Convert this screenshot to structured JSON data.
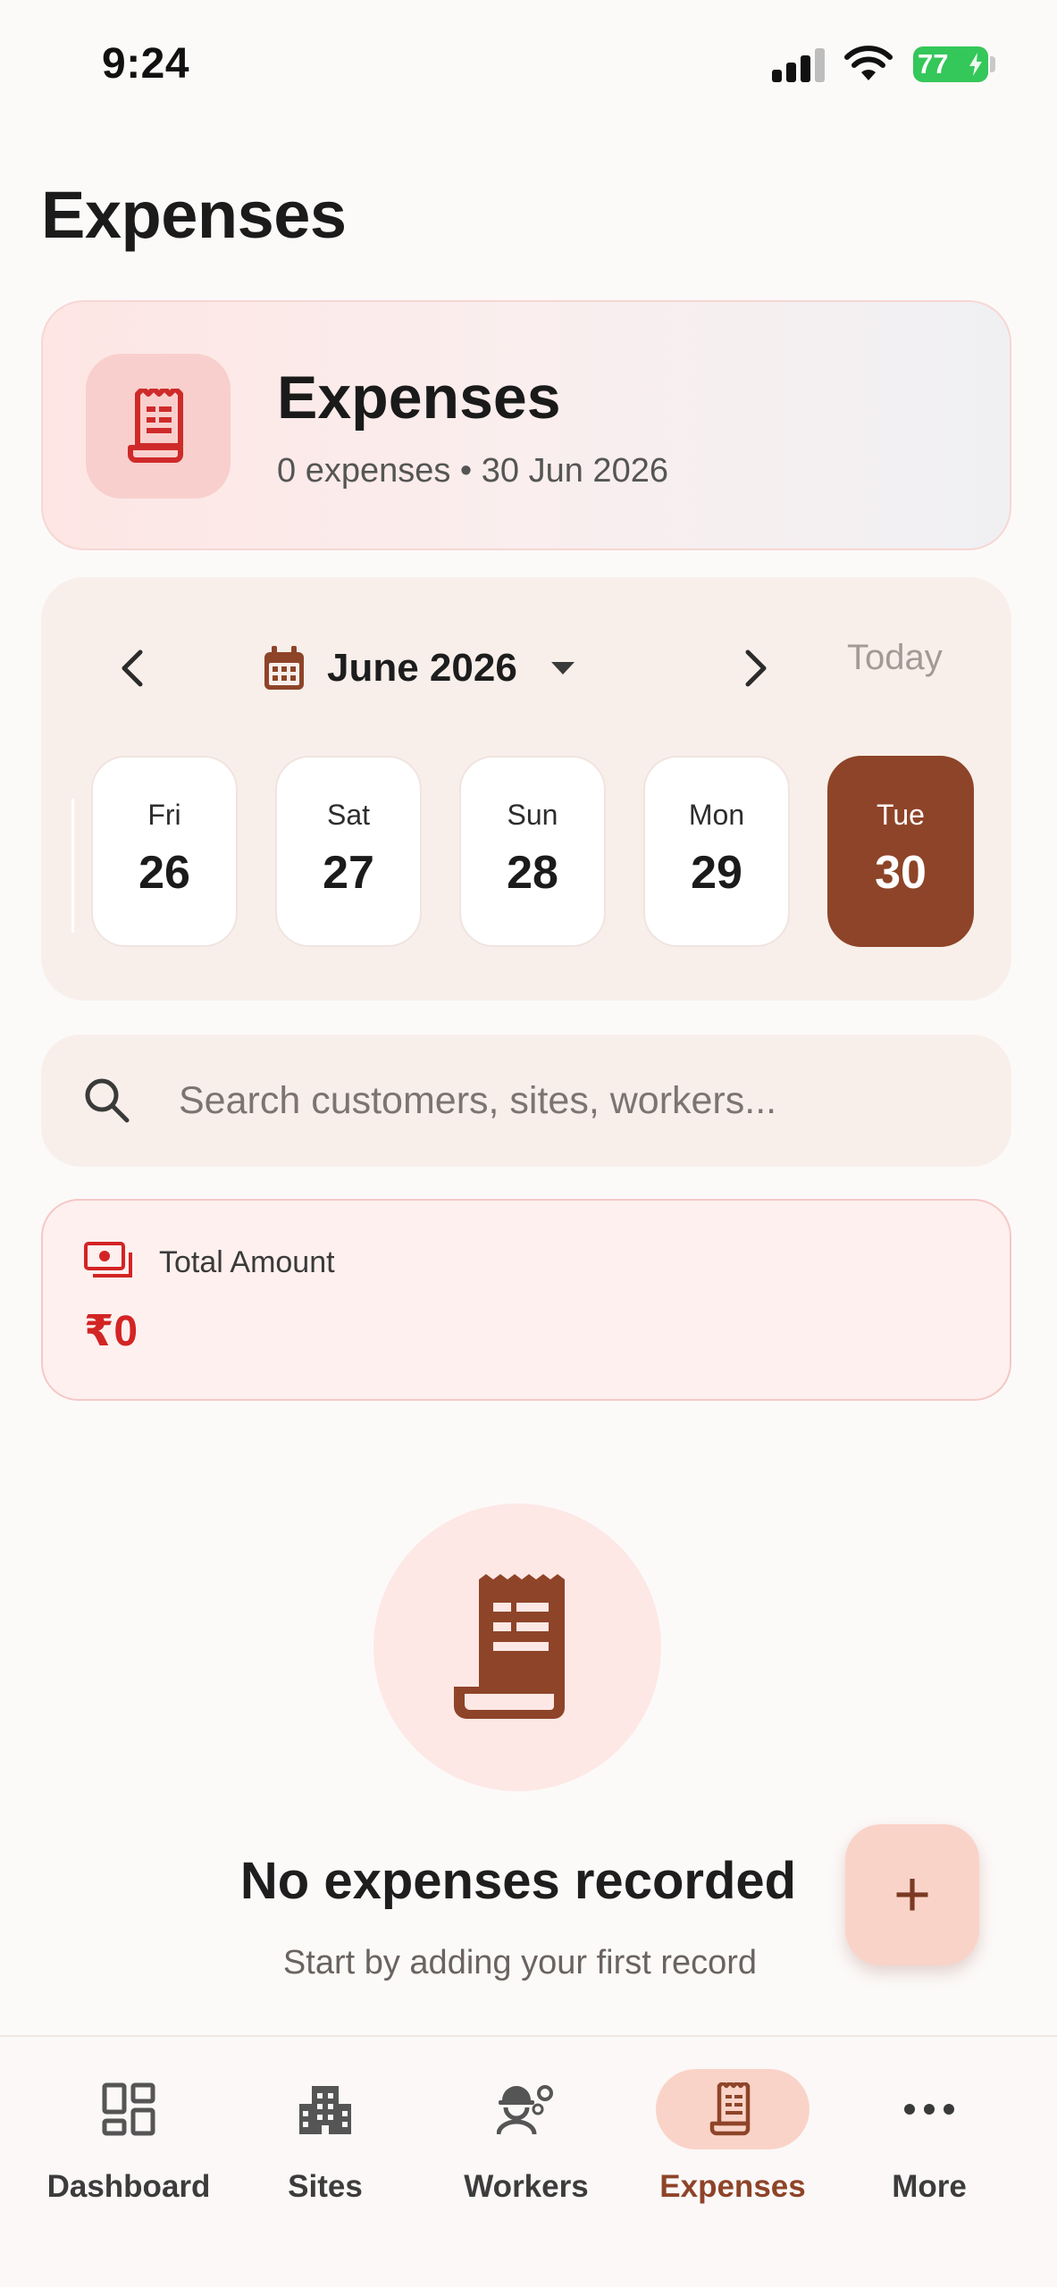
{
  "status_bar": {
    "time": "9:24",
    "battery": "77"
  },
  "page": {
    "title": "Expenses"
  },
  "header_card": {
    "title": "Expenses",
    "subtitle": "0 expenses • 30 Jun 2026",
    "icon": "receipt-icon"
  },
  "calendar": {
    "month_label": "June 2026",
    "today_label": "Today",
    "days": [
      {
        "name": "Fri",
        "num": "26"
      },
      {
        "name": "Sat",
        "num": "27"
      },
      {
        "name": "Sun",
        "num": "28"
      },
      {
        "name": "Mon",
        "num": "29"
      },
      {
        "name": "Tue",
        "num": "30"
      }
    ],
    "selected": "30"
  },
  "search": {
    "placeholder": "Search customers, sites, workers..."
  },
  "total": {
    "label": "Total Amount",
    "value": "₹0"
  },
  "empty_state": {
    "title": "No expenses recorded",
    "subtitle": "Start by adding your first record"
  },
  "fab": {
    "label": "+"
  },
  "nav": {
    "items": [
      {
        "label": "Dashboard",
        "icon": "dashboard-icon"
      },
      {
        "label": "Sites",
        "icon": "building-icon"
      },
      {
        "label": "Workers",
        "icon": "worker-icon"
      },
      {
        "label": "Expenses",
        "icon": "receipt-icon"
      },
      {
        "label": "More",
        "icon": "more-icon"
      }
    ],
    "active": "Expenses"
  },
  "colors": {
    "accent": "#8e4428",
    "danger": "#d32424",
    "icon_red": "#cf2a2a"
  }
}
